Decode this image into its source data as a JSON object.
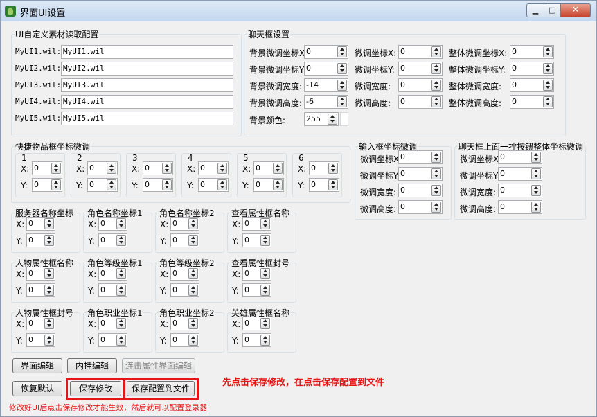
{
  "window": {
    "title": "界面UI设置",
    "min_glyph": "▁",
    "max_glyph": "□",
    "close_glyph": "✕",
    "icon": "app-leaf-icon"
  },
  "ui_config": {
    "legend": "UI自定义素材读取配置",
    "rows": [
      {
        "label": "MyUI1.wil:",
        "value": "MyUI1.wil"
      },
      {
        "label": "MyUI2.wil:",
        "value": "MyUI2.wil"
      },
      {
        "label": "MyUI3.wil:",
        "value": "MyUI3.wil"
      },
      {
        "label": "MyUI4.wil:",
        "value": "MyUI4.wil"
      },
      {
        "label": "MyUI5.wil:",
        "value": "MyUI5.wil"
      }
    ]
  },
  "chat_box": {
    "legend": "聊天框设置",
    "col1": [
      {
        "label": "背景微调坐标X",
        "value": "0"
      },
      {
        "label": "背景微调坐标Y",
        "value": "0"
      },
      {
        "label": "背景微调宽度:",
        "value": "-14"
      },
      {
        "label": "背景微调高度:",
        "value": "-6"
      }
    ],
    "col2": [
      {
        "label": "微调坐标X:",
        "value": "0"
      },
      {
        "label": "微调坐标Y:",
        "value": "0"
      },
      {
        "label": "微调宽度:",
        "value": "0"
      },
      {
        "label": "微调高度:",
        "value": "0"
      }
    ],
    "col3": [
      {
        "label": "整体微调坐标X:",
        "value": "0"
      },
      {
        "label": "整体微调坐标Y:",
        "value": "0"
      },
      {
        "label": "整体微调宽度:",
        "value": "0"
      },
      {
        "label": "整体微调高度:",
        "value": "0"
      }
    ],
    "bg_color_label": "背景颜色:",
    "bg_color_value": "255"
  },
  "quick_items": {
    "legend": "快捷物品框坐标微调",
    "x_label": "X:",
    "y_label": "Y:",
    "slots": [
      {
        "label": "1",
        "x": "0",
        "y": "0"
      },
      {
        "label": "2",
        "x": "0",
        "y": "0"
      },
      {
        "label": "3",
        "x": "0",
        "y": "0"
      },
      {
        "label": "4",
        "x": "0",
        "y": "0"
      },
      {
        "label": "5",
        "x": "0",
        "y": "0"
      },
      {
        "label": "6",
        "x": "0",
        "y": "0"
      }
    ]
  },
  "input_box": {
    "legend": "输入框坐标微调",
    "rows": [
      {
        "label": "微调坐标X",
        "value": "0"
      },
      {
        "label": "微调坐标Y",
        "value": "0"
      },
      {
        "label": "微调宽度:",
        "value": "0"
      },
      {
        "label": "微调高度:",
        "value": "0"
      }
    ]
  },
  "chat_top_buttons": {
    "legend": "聊天框上面一排按钮整体坐标微调",
    "rows": [
      {
        "label": "微调坐标X",
        "value": "0"
      },
      {
        "label": "微调坐标Y",
        "value": "0"
      },
      {
        "label": "微调宽度:",
        "value": "0"
      },
      {
        "label": "微调高度:",
        "value": "0"
      }
    ]
  },
  "coord_groups": [
    {
      "legend": "服务器名称坐标",
      "x": "0",
      "y": "0"
    },
    {
      "legend": "角色名称坐标1",
      "x": "0",
      "y": "0"
    },
    {
      "legend": "角色名称坐标2",
      "x": "0",
      "y": "0"
    },
    {
      "legend": "查看属性框名称",
      "x": "0",
      "y": "0"
    },
    {
      "legend": "人物属性框名称",
      "x": "0",
      "y": "0"
    },
    {
      "legend": "角色等级坐标1",
      "x": "0",
      "y": "0"
    },
    {
      "legend": "角色等级坐标2",
      "x": "0",
      "y": "0"
    },
    {
      "legend": "查看属性框封号",
      "x": "0",
      "y": "0"
    },
    {
      "legend": "人物属性框封号",
      "x": "0",
      "y": "0"
    },
    {
      "legend": "角色职业坐标1",
      "x": "0",
      "y": "0"
    },
    {
      "legend": "角色职业坐标2",
      "x": "0",
      "y": "0"
    },
    {
      "legend": "英雄属性框名称",
      "x": "0",
      "y": "0"
    }
  ],
  "buttons": {
    "ui_edit": "界面编辑",
    "hook_edit": "内挂编辑",
    "attr_ui_edit": "连击属性界面编辑",
    "restore_default": "恢复默认",
    "save_changes": "保存修改",
    "save_to_file": "保存配置到文件"
  },
  "notes": {
    "hint_right": "先点击保存修改，在点击保存配置到文件",
    "hint_bottom": "修改好UI后点击保存修改才能生效，然后就可以配置登录器"
  },
  "colors": {
    "highlight_red": "#e51616"
  }
}
